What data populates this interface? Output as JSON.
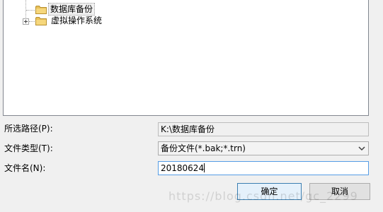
{
  "tree": {
    "nodes": [
      {
        "label": "数据库备份",
        "selected": true,
        "expandable": false,
        "icon": "folder-icon"
      },
      {
        "label": "虚拟操作系统",
        "selected": false,
        "expandable": true,
        "icon": "folder-icon"
      }
    ]
  },
  "form": {
    "path_label": "所选路径(P):",
    "path_value": "K:\\数据库备份",
    "filetype_label": "文件类型(T):",
    "filetype_value": "备份文件(*.bak;*.trn)",
    "filename_label": "文件名(N):",
    "filename_value": "20180624"
  },
  "buttons": {
    "ok": "确定",
    "cancel": "取消"
  },
  "watermark": "https://blog.csdn.net/gc_2299",
  "colors": {
    "folder": "#e8c05a",
    "focus_border": "#569de5",
    "default_button_border": "#3c7fb1"
  }
}
